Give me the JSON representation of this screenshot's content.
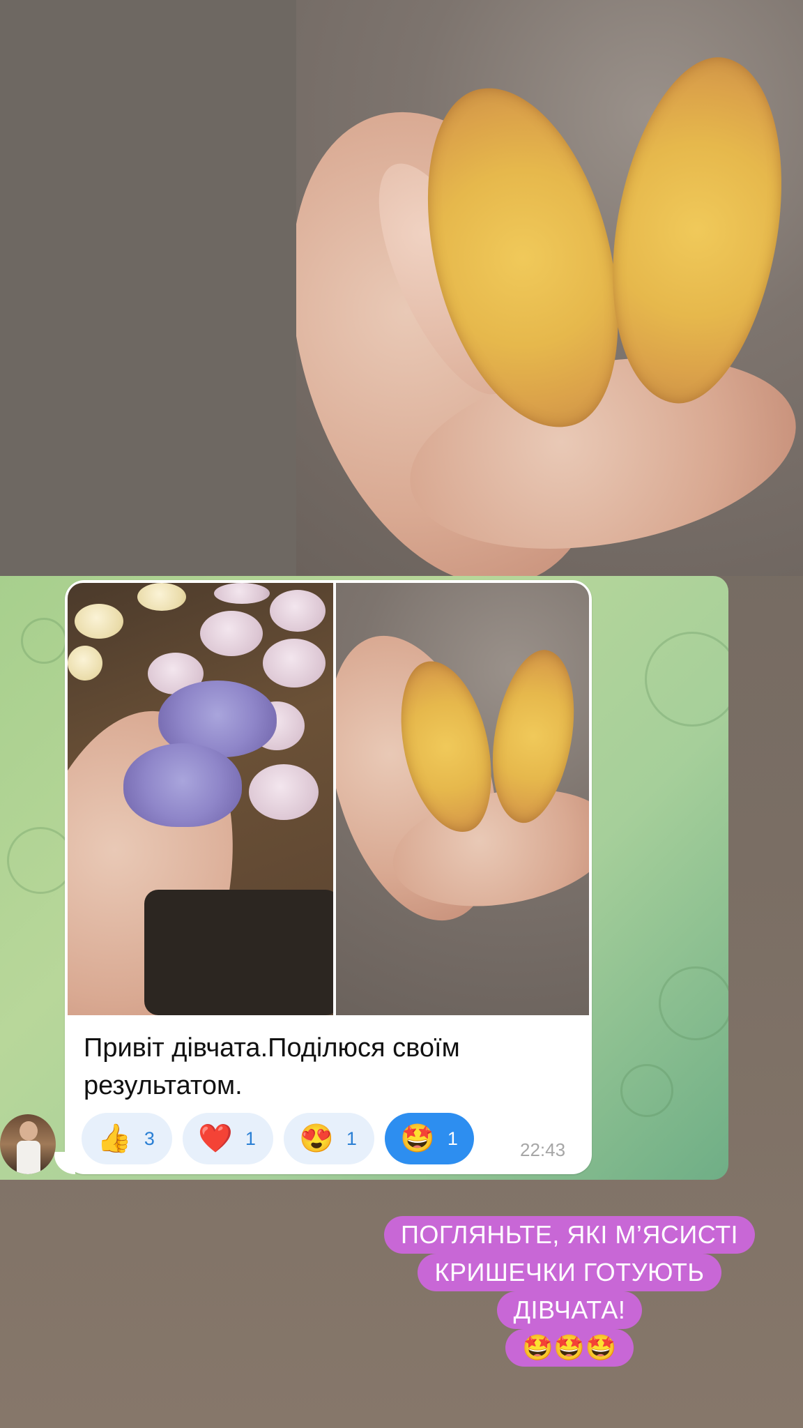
{
  "message": {
    "text": "Привіт дівчата.Поділюся своїм результатом.",
    "time": "22:43",
    "reactions": [
      {
        "emoji": "👍",
        "count": "3",
        "active": false
      },
      {
        "emoji": "❤️",
        "count": "1",
        "active": false
      },
      {
        "emoji": "😍",
        "count": "1",
        "active": false
      },
      {
        "emoji": "🤩",
        "count": "1",
        "active": true
      }
    ]
  },
  "sticker": {
    "line1": "ПОГЛЯНЬТЕ, ЯКІ М’ЯСИСТІ",
    "line2": "КРИШЕЧКИ ГОТУЮТЬ",
    "line3": "ДІВЧАТА!",
    "line4": "🤩🤩🤩"
  },
  "colors": {
    "reaction_active": "#2d8ef0",
    "reaction_bg": "#e7f0fb",
    "sticker_bg": "#c867d6",
    "chat_bg": "#a7cf8d"
  }
}
